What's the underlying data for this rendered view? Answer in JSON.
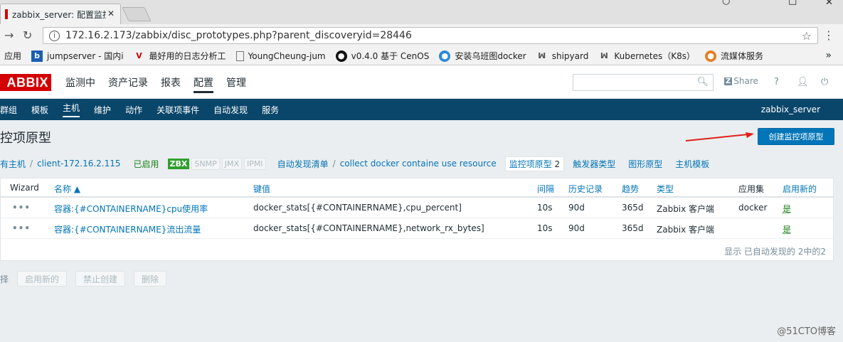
{
  "browser": {
    "tab_title": "zabbix_server: 配置监控",
    "tab_close": "✕",
    "url": "172.16.2.173/zabbix/disc_prototypes.php?parent_discoveryid=28446",
    "bookmarks": [
      {
        "label": "应用",
        "icon": "apps-icon"
      },
      {
        "label": "jumpserver - 国内i",
        "icon": "b-icon"
      },
      {
        "label": "最好用的日志分析工",
        "icon": "v-icon"
      },
      {
        "label": "YoungCheung-jum",
        "icon": "page-icon"
      },
      {
        "label": "v0.4.0 基于 CenOS",
        "icon": "github-icon"
      },
      {
        "label": "安装乌班图docker",
        "icon": "blue-icon"
      },
      {
        "label": "shipyard",
        "icon": "w-icon"
      },
      {
        "label": "Kubernetes（K8s）",
        "icon": "w-icon"
      },
      {
        "label": "流媒体服务",
        "icon": "orange-icon"
      }
    ],
    "more": "»"
  },
  "header": {
    "logo": "ABBIX",
    "nav": [
      "监测中",
      "资产记录",
      "报表",
      "配置",
      "管理"
    ],
    "active_nav": "配置",
    "share": "Share",
    "help": "?",
    "server_name": "zabbix_server"
  },
  "subnav": [
    "群组",
    "模板",
    "主机",
    "维护",
    "动作",
    "关联项事件",
    "自动发现",
    "服务"
  ],
  "page": {
    "title": "控项原型",
    "create_button": "创建监控项原型"
  },
  "breadcrumbs": {
    "all_hosts": "有主机",
    "host": "client-172.16.2.115",
    "status": "已启用",
    "badges": [
      "ZBX",
      "SNMP",
      "JMX",
      "IPMI"
    ],
    "discovery_list": "自动发现清单",
    "rule": "collect docker containe use resource",
    "item_prototypes": "监控项原型",
    "item_prototypes_count": "2",
    "trigger_types": "触发器类型",
    "graph_prototypes": "图形原型",
    "host_templates": "主机模板"
  },
  "table": {
    "columns": [
      "Wizard",
      "名称 ▲",
      "键值",
      "间隔",
      "历史记录",
      "趋势",
      "类型",
      "应用集",
      "启用新的"
    ],
    "rows": [
      {
        "wizard": "•••",
        "name": "容器:{#CONTAINERNAME}cpu使用率",
        "key": "docker_stats[{#CONTAINERNAME},cpu_percent]",
        "interval": "10s",
        "history": "90d",
        "trends": "365d",
        "type": "Zabbix 客户端",
        "app": "docker",
        "enabled": "是"
      },
      {
        "wizard": "•••",
        "name": "容器:{#CONTAINERNAME}流出流量",
        "key": "docker_stats[{#CONTAINERNAME},network_rx_bytes]",
        "interval": "10s",
        "history": "90d",
        "trends": "365d",
        "type": "Zabbix 客户端",
        "app": "",
        "enabled": "是"
      }
    ],
    "footer": "显示 已自动发现的 2中的2"
  },
  "actions": {
    "select_label": "择",
    "buttons": [
      "启用新的",
      "禁止创建",
      "删除"
    ]
  },
  "watermark": "@51CTO博客"
}
